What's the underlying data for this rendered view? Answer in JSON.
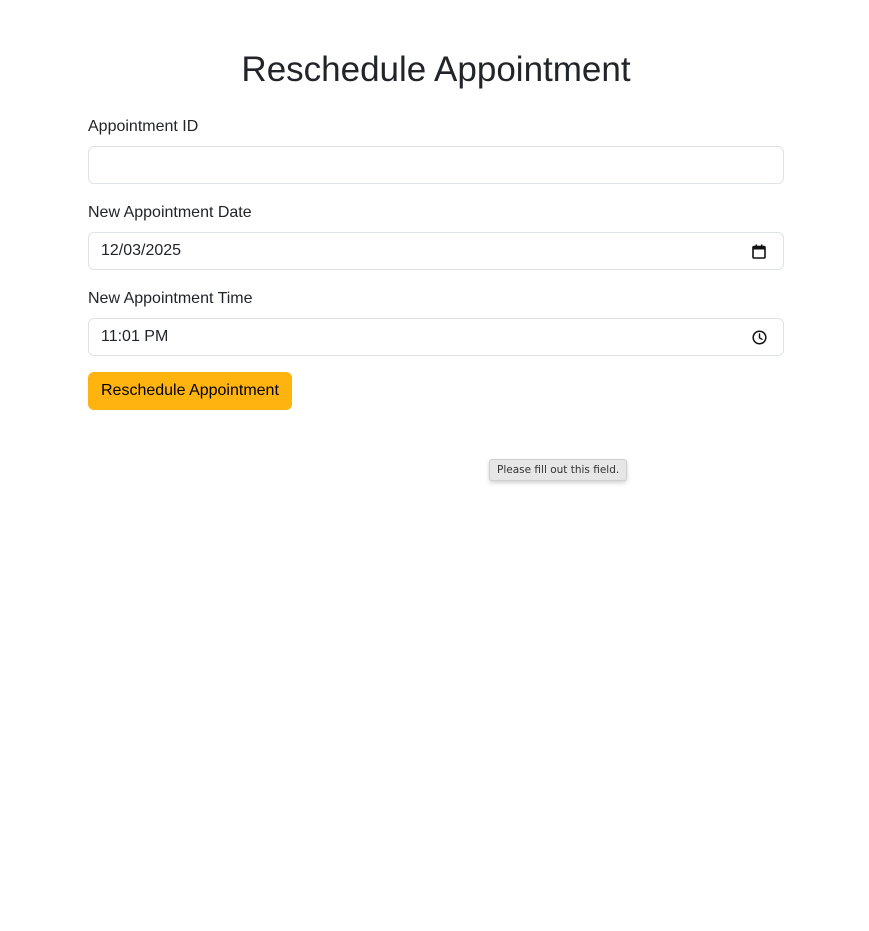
{
  "page": {
    "title": "Reschedule Appointment"
  },
  "form": {
    "appointment_id": {
      "label": "Appointment ID",
      "value": ""
    },
    "date": {
      "label": "New Appointment Date",
      "value": "12/03/2025",
      "icon": "calendar-icon"
    },
    "time": {
      "label": "New Appointment Time",
      "value": "11:01 PM",
      "icon": "clock-icon"
    },
    "submit_label": "Reschedule Appointment"
  },
  "validation_tooltip": "Please fill out this field.",
  "colors": {
    "accent": "#ffb30f",
    "border": "#dee2e6",
    "text": "#212529"
  }
}
